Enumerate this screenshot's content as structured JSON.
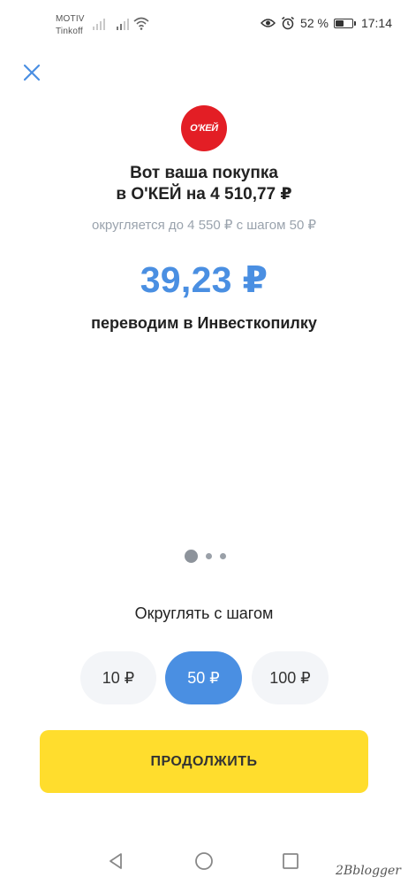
{
  "status_bar": {
    "carrier_1": "MOTIV",
    "carrier_2": "Tinkoff",
    "battery_percent": "52 %",
    "battery_level": 0.52,
    "time": "17:14",
    "icons": [
      "signal-icon",
      "wifi-icon",
      "eye-icon",
      "alarm-icon",
      "battery-icon"
    ]
  },
  "header": {
    "close_icon": "close-icon"
  },
  "merchant": {
    "logo_text": "О'КЕЙ",
    "logo_color": "#e31e25"
  },
  "purchase": {
    "title_line1": "Вот ваша покупка",
    "title_line2": "в О'КЕЙ на 4 510,77 ₽",
    "rounding_note": "округляется до 4 550 ₽ с шагом 50 ₽",
    "amount": "39,23 ₽",
    "destination": "переводим в Инвесткопилку"
  },
  "pager": {
    "count": 3,
    "active_index": 0
  },
  "rounding": {
    "label": "Округлять с шагом",
    "options": [
      {
        "label": "10 ₽",
        "selected": false
      },
      {
        "label": "50 ₽",
        "selected": true
      },
      {
        "label": "100 ₽",
        "selected": false
      }
    ]
  },
  "actions": {
    "continue_label": "ПРОДОЛЖИТЬ",
    "continue_color": "#ffdd2d"
  },
  "colors": {
    "accent": "#4a8fe2",
    "muted_text": "#9aa3ad",
    "step_bg": "#f3f5f8"
  },
  "nav_bar": {
    "icons": [
      "back-icon",
      "home-icon",
      "recents-icon"
    ]
  },
  "watermark": "2Bblogger"
}
